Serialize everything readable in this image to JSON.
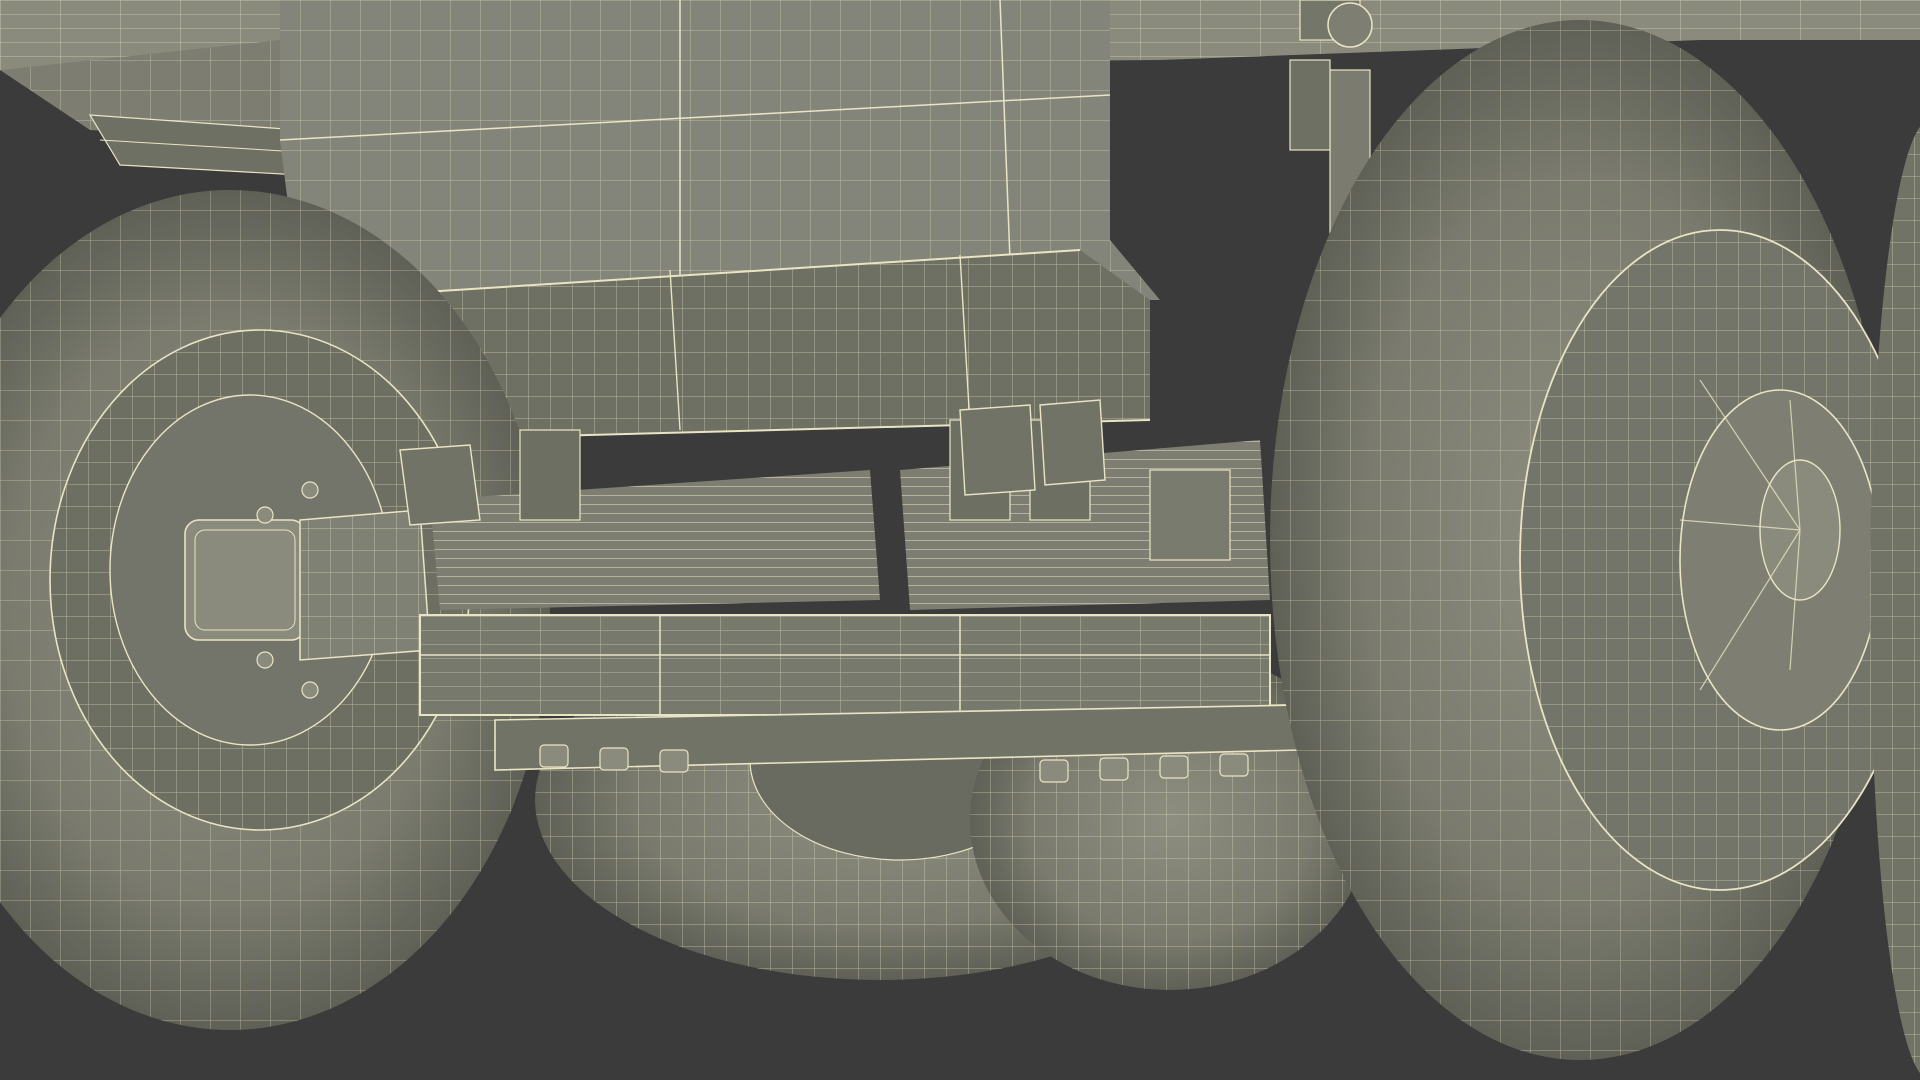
{
  "scene": {
    "subject": "wireframe-truck-undercarriage",
    "colors": {
      "background": "#3a3b3a",
      "body_fill": "#8a8b7c",
      "body_dark": "#6f7064",
      "tire_fill": "#7c7d70",
      "tire_dark": "#5e5f55",
      "wire": "#e9e4c4",
      "wire_dim": "#cfcab0"
    }
  }
}
